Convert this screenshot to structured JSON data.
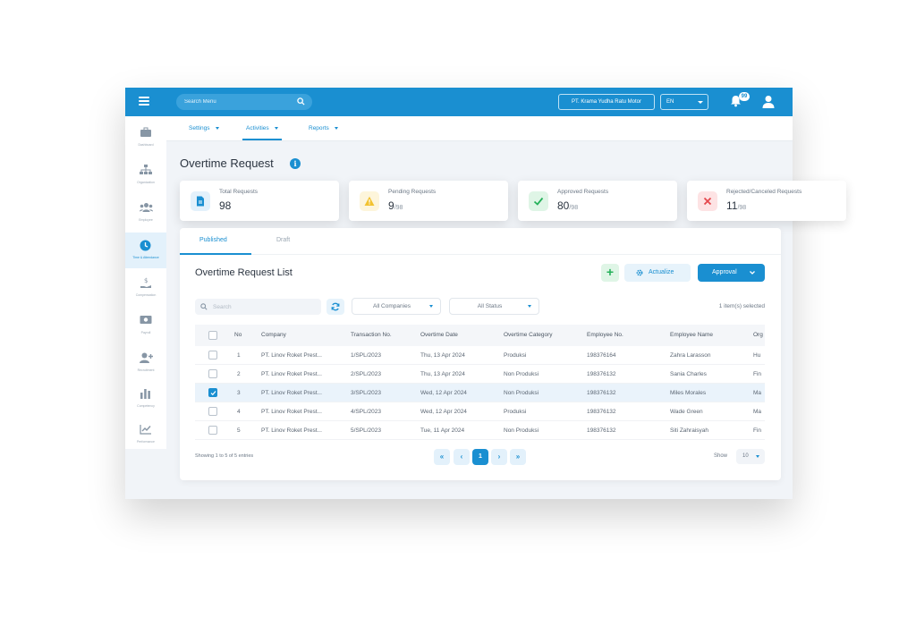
{
  "topbar": {
    "search_placeholder": "Search Menu",
    "company": "PT. Krama Yudha Ratu Motor",
    "language": "EN",
    "notification_count": "99"
  },
  "sidebar": {
    "items": [
      {
        "label": "Dashboard",
        "icon": "briefcase-icon"
      },
      {
        "label": "Organization",
        "icon": "org-chart-icon"
      },
      {
        "label": "Employee",
        "icon": "users-icon"
      },
      {
        "label": "Time & Attendance",
        "icon": "clock-icon"
      },
      {
        "label": "Compensation",
        "icon": "money-hand-icon"
      },
      {
        "label": "Payroll",
        "icon": "banknote-icon"
      },
      {
        "label": "Recruitment",
        "icon": "add-user-icon"
      },
      {
        "label": "Competency",
        "icon": "bar-chart-icon"
      },
      {
        "label": "Performance",
        "icon": "trend-chart-icon"
      }
    ]
  },
  "subnav": {
    "settings": "Settings",
    "activities": "Activities",
    "reports": "Reports"
  },
  "page": {
    "title": "Overtime Request"
  },
  "stats": [
    {
      "title": "Total Requests",
      "value": "98",
      "suffix": ""
    },
    {
      "title": "Pending Requests",
      "value": "9",
      "suffix": "/98"
    },
    {
      "title": "Approved Requests",
      "value": "80",
      "suffix": "/98"
    },
    {
      "title": "Rejected/Canceled Requests",
      "value": "11",
      "suffix": "/98"
    }
  ],
  "tabs": {
    "published": "Published",
    "draft": "Draft"
  },
  "list": {
    "title": "Overtime Request List",
    "add_label": "+",
    "actualize_label": "Actualize",
    "approval_label": "Approval",
    "search_placeholder": "Search",
    "companies_filter": "All Companies",
    "status_filter": "All Status",
    "selected_text": "1 item(s) selected"
  },
  "table": {
    "headers": [
      "No",
      "Company",
      "Transaction No.",
      "Overtime Date",
      "Overtime Category",
      "Employee No.",
      "Employee Name",
      "Org"
    ],
    "rows": [
      {
        "no": "1",
        "company": "PT. Linov Roket Prest...",
        "trx": "1/SPL/2023",
        "date": "Thu, 13 Apr 2024",
        "category": "Produksi",
        "emp_no": "198376164",
        "name": "Zahra Larasson",
        "org": "Hu",
        "checked": false
      },
      {
        "no": "2",
        "company": "PT. Linov Roket Prest...",
        "trx": "2/SPL/2023",
        "date": "Thu, 13 Apr 2024",
        "category": "Non Produksi",
        "emp_no": "198376132",
        "name": "Sania Charles",
        "org": "Fin",
        "checked": false
      },
      {
        "no": "3",
        "company": "PT. Linov Roket Prest...",
        "trx": "3/SPL/2023",
        "date": "Wed, 12 Apr 2024",
        "category": "Non Produksi",
        "emp_no": "198376132",
        "name": "Miles Morales",
        "org": "Ma",
        "checked": true
      },
      {
        "no": "4",
        "company": "PT. Linov Roket Prest...",
        "trx": "4/SPL/2023",
        "date": "Wed, 12 Apr 2024",
        "category": "Produksi",
        "emp_no": "198376132",
        "name": "Wade Green",
        "org": "Ma",
        "checked": false
      },
      {
        "no": "5",
        "company": "PT. Linov Roket Prest...",
        "trx": "5/SPL/2023",
        "date": "Tue, 11 Apr 2024",
        "category": "Non Produksi",
        "emp_no": "198376132",
        "name": "Siti Zahraisyah",
        "org": "Fin",
        "checked": false
      }
    ]
  },
  "footer": {
    "showing": "Showing 1 to 5 of 5 entries",
    "current_page": "1",
    "show_label": "Show",
    "page_size": "10"
  },
  "colors": {
    "primary": "#1a8fd1",
    "success": "#25b15a",
    "warning": "#f2c230",
    "danger": "#e5484d"
  }
}
